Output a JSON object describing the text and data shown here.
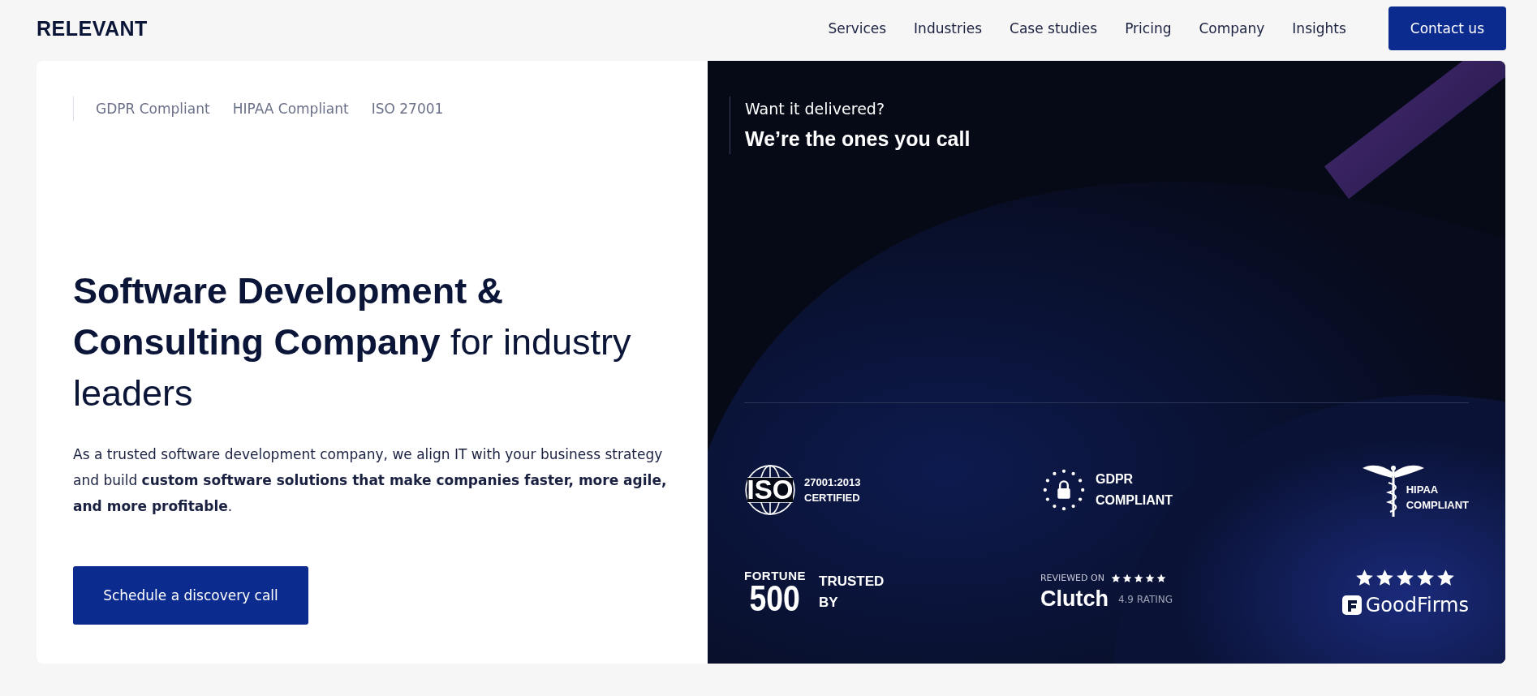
{
  "header": {
    "logo": "RELEVANT",
    "nav": [
      "Services",
      "Industries",
      "Case studies",
      "Pricing",
      "Company",
      "Insights"
    ],
    "cta": "Contact us"
  },
  "hero": {
    "compliance": [
      "GDPR Compliant",
      "HIPAA Compliant",
      "ISO 27001"
    ],
    "title": "**Software Development & Consulting Company** for industry leaders",
    "description": "As a trusted software development company, we align IT with your business strategy and build **custom software solutions that make companies faster, more agile, and more profitable**.",
    "button": "Schedule a discovery call"
  },
  "panel": {
    "eyebrow": "Want it delivered?",
    "headline": "We’re the ones you call",
    "badges": [
      {
        "kind": "iso",
        "mark": "ISO",
        "lines": [
          "27001:2013",
          "CERTIFIED"
        ]
      },
      {
        "kind": "gdpr",
        "lines": [
          "GDPR",
          "COMPLIANT"
        ]
      },
      {
        "kind": "hipaa",
        "lines": [
          "HIPAA",
          "COMPLIANT"
        ]
      },
      {
        "kind": "fortune",
        "mark": "FORTUNE",
        "number": "500",
        "lines": [
          "TRUSTED",
          "BY"
        ]
      },
      {
        "kind": "clutch",
        "caption": "REVIEWED ON",
        "stars": 5,
        "mark": "Clutch",
        "rating": "4.9 RATING"
      },
      {
        "kind": "goodfirms",
        "stars": 5,
        "mark": "GoodFirms"
      }
    ]
  }
}
